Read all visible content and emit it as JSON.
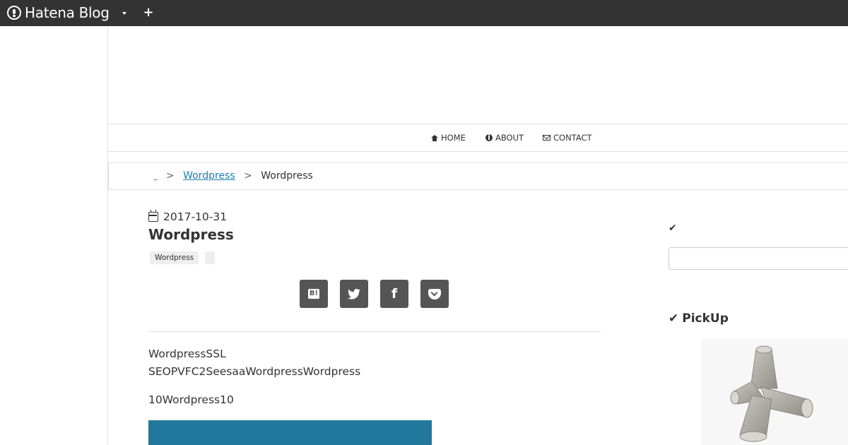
{
  "topbar": {
    "logo_text": "Hatena Blog",
    "dropdown_icon": "caret-down-icon",
    "plus_label": "+"
  },
  "nav": {
    "items": [
      {
        "label": "HOME",
        "icon": "home-icon"
      },
      {
        "label": "ABOUT",
        "icon": "info-icon"
      },
      {
        "label": "CONTACT",
        "icon": "envelope-icon"
      }
    ]
  },
  "breadcrumb": {
    "root": " ",
    "sep1": ">",
    "category": "Wordpress",
    "sep2": ">",
    "current": "Wordpress"
  },
  "article": {
    "date": "2017-10-31",
    "title": "Wordpress",
    "tags": [
      "Wordpress",
      ""
    ],
    "share": {
      "hatena_label": "B!",
      "twitter_icon": "twitter-icon",
      "facebook_label": "f",
      "pocket_icon": "pocket-icon"
    },
    "body": {
      "p1_line1": "WordpressSSL",
      "p1_line2": "SEOPVFC2SeesaaWordpressWordpress",
      "p2": "10Wordpress10"
    },
    "image_color": "#21779c"
  },
  "sidebar": {
    "check_label": "✔",
    "search_placeholder": "",
    "pickup_title": "PickUp"
  },
  "colors": {
    "topbar_bg": "#333333",
    "link": "#1a7fb0",
    "share_button_bg": "#555555"
  }
}
